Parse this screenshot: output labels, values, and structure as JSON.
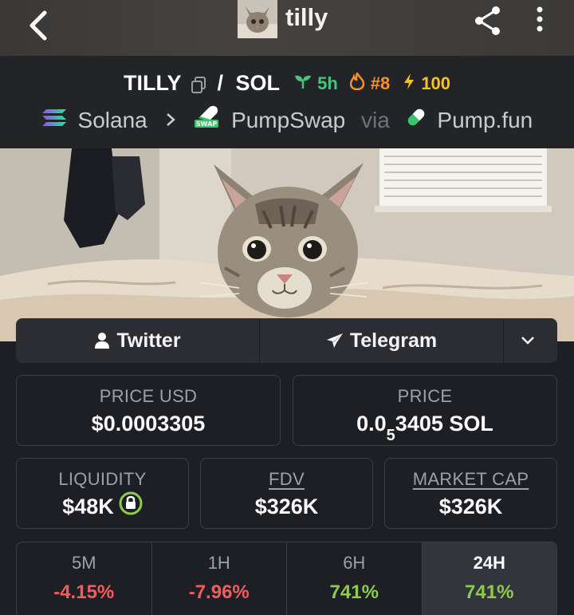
{
  "topbar": {
    "title": "tilly",
    "back_icon": "chevron-left-icon",
    "share_icon": "share-icon",
    "menu_icon": "kebab-menu-icon"
  },
  "pair": {
    "base": "TILLY",
    "separator": "/",
    "quote": "SOL",
    "age": "5h",
    "rank": "#8",
    "boosts": "100",
    "chain": "Solana",
    "dex": "PumpSwap",
    "via": "via",
    "launchpad": "Pump.fun",
    "dex_badge": "SWAP",
    "colors": {
      "age": "#44c77a",
      "rank": "#f7931e",
      "boosts": "#f6c21c"
    }
  },
  "socials": {
    "twitter": "Twitter",
    "telegram": "Telegram"
  },
  "stats": {
    "price_usd_label": "PRICE USD",
    "price_usd": "$0.0003305",
    "price_label": "PRICE",
    "price_native_prefix": "0.0",
    "price_native_zeros": "5",
    "price_native_rest": "3405 SOL",
    "liquidity_label": "LIQUIDITY",
    "liquidity": "$48K",
    "fdv_label": "FDV",
    "fdv": "$326K",
    "mcap_label": "MARKET CAP",
    "mcap": "$326K"
  },
  "changes": [
    {
      "label": "5M",
      "value": "-4.15%",
      "trend": "down"
    },
    {
      "label": "1H",
      "value": "-7.96%",
      "trend": "down"
    },
    {
      "label": "6H",
      "value": "741%",
      "trend": "up"
    },
    {
      "label": "24H",
      "value": "741%",
      "trend": "up",
      "active": true
    }
  ]
}
